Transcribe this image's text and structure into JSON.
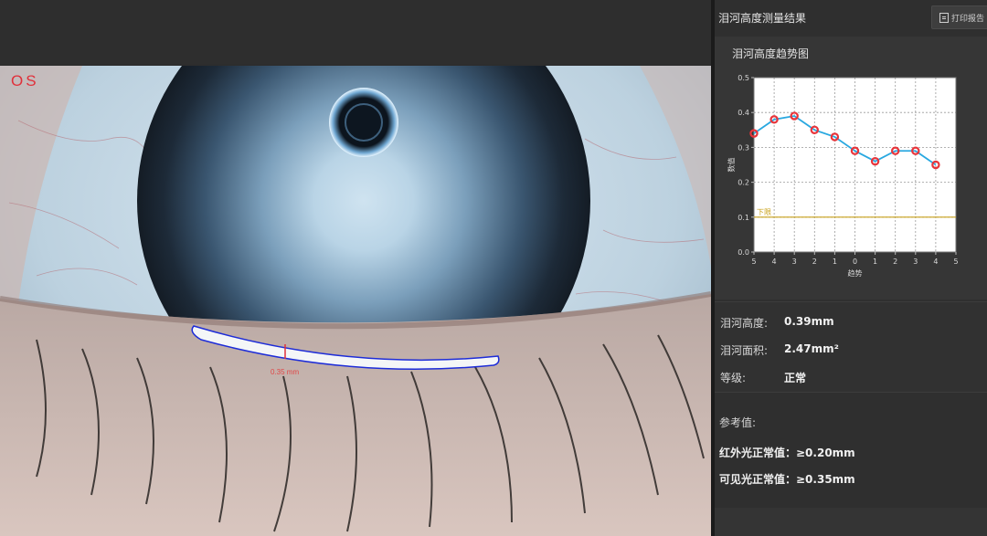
{
  "image": {
    "eye_label": "OS",
    "measurement_label": "0.35 mm"
  },
  "panel": {
    "title": "泪河高度测量结果",
    "print_button": "打印报告",
    "print_icon": "printer-report-icon"
  },
  "chart_data": {
    "type": "line",
    "title": "泪河高度趋势图",
    "xlabel": "趋势",
    "ylabel": "数值",
    "x_ticks": [
      "5",
      "4",
      "3",
      "2",
      "1",
      "0",
      "1",
      "2",
      "3",
      "4",
      "5"
    ],
    "x_positions": [
      -5,
      -4,
      -3,
      -2,
      -1,
      0,
      1,
      2,
      3,
      4,
      5
    ],
    "ylim": [
      0.0,
      0.5
    ],
    "y_ticks": [
      "0.0",
      "0.1",
      "0.2",
      "0.3",
      "0.4",
      "0.5"
    ],
    "grid": true,
    "series": [
      {
        "x": [
          -5,
          -4,
          -3,
          -2,
          -1,
          0,
          1,
          2,
          3,
          4
        ],
        "values": [
          0.34,
          0.38,
          0.39,
          0.35,
          0.33,
          0.29,
          0.26,
          0.29,
          0.29,
          0.25
        ],
        "color": "#29a8e0",
        "marker_color": "#e8343a"
      }
    ],
    "reference_line": {
      "name": "下限",
      "value": 0.1,
      "color": "#c8a018"
    }
  },
  "metrics": [
    {
      "label": "泪河高度:",
      "value": "0.39mm"
    },
    {
      "label": "泪河面积:",
      "value": "2.47mm²"
    },
    {
      "label": "等级:",
      "value": "正常"
    }
  ],
  "reference": {
    "title": "参考值:",
    "items": [
      {
        "text": "红外光正常值：≥0.20mm"
      },
      {
        "text": "可见光正常值：≥0.35mm"
      }
    ]
  }
}
